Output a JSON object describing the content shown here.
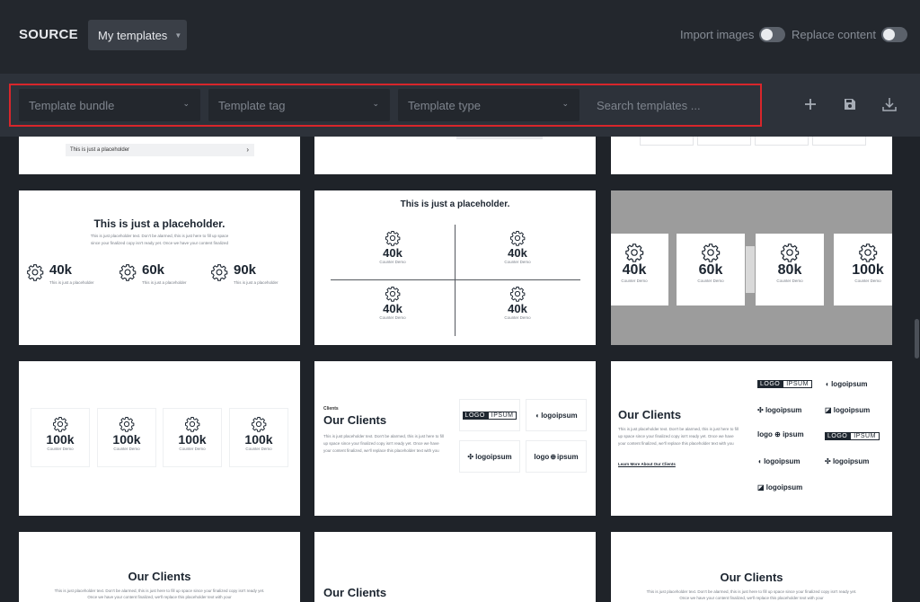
{
  "topbar": {
    "brand": "SOURCE",
    "templates_select": "My templates",
    "import_images_label": "Import images",
    "replace_content_label": "Replace content"
  },
  "filters": {
    "bundle_placeholder": "Template bundle",
    "tag_placeholder": "Template tag",
    "type_placeholder": "Template type",
    "search_placeholder": "Search templates ..."
  },
  "icons": {
    "add": "plus-icon",
    "save": "save-icon",
    "download": "download-icon"
  },
  "colors": {
    "highlight_outline": "#d8262b",
    "topbar_bg": "#23272d",
    "filterbar_bg": "#2d323a"
  },
  "cards": {
    "row0": {
      "placeholder_bar": "This is just a placeholder"
    },
    "counter1": {
      "title": "This is just a placeholder.",
      "desc": "This is just placeholder text. Don't be alarmed, this is just here to fill up space since your finalized copy isn't ready yet. Once we have your content finalized",
      "items": [
        {
          "value": "40k",
          "caption": "This is just a placeholder"
        },
        {
          "value": "60k",
          "caption": "This is just a placeholder"
        },
        {
          "value": "90k",
          "caption": "This is just a placeholder"
        }
      ]
    },
    "counter2": {
      "title": "This is just a placeholder.",
      "items": [
        {
          "value": "40k",
          "caption": "Counter Demo"
        },
        {
          "value": "40k",
          "caption": "Counter Demo"
        },
        {
          "value": "40k",
          "caption": "Counter Demo"
        },
        {
          "value": "40k",
          "caption": "Counter Demo"
        }
      ]
    },
    "counter3": {
      "items": [
        {
          "value": "40k",
          "caption": "Counter Demo"
        },
        {
          "value": "60k",
          "caption": "Counter Demo"
        },
        {
          "value": "80k",
          "caption": "Counter Demo"
        },
        {
          "value": "100k",
          "caption": "Counter Demo"
        }
      ]
    },
    "counter4": {
      "items": [
        {
          "value": "100k",
          "caption": "Counter Demo"
        },
        {
          "value": "100k",
          "caption": "Counter Demo"
        },
        {
          "value": "100k",
          "caption": "Counter Demo"
        },
        {
          "value": "100k",
          "caption": "Counter Demo"
        }
      ]
    },
    "clients1": {
      "eyebrow": "Clients",
      "title": "Our Clients",
      "desc": "This is just placeholder text. Don't be alarmed, this is just here to fill up space since your finalized copy isn't ready yet. Once we have your content finalized, we'll replace this placeholder text with you",
      "logos": [
        "LOGO",
        "IPSUM",
        "logoipsum",
        "logoipsum",
        "logo",
        "ipsum"
      ]
    },
    "clients2": {
      "title": "Our Clients",
      "desc": "This is just placeholder text. Don't be alarmed, this is just here to fill up space since your finalized copy isn't ready yet. Once we have your content finalized, we'll replace this placeholder text with you",
      "link": "Learn More About Our Clients",
      "logos": [
        "LOGO",
        "IPSUM",
        "logoipsum",
        "logoipsum",
        "logoipsum",
        "logo",
        "ipsum",
        "LOGO",
        "IPSUM",
        "logoipsum",
        "logoipsum",
        "logoipsum"
      ]
    },
    "clients3": {
      "title": "Our Clients",
      "desc": "This is just placeholder text. Don't be alarmed, this is just here to fill up space since your finalized copy isn't ready yet. Once we have your content finalized, we'll replace this placeholder text with your"
    },
    "clients4": {
      "title": "Our Clients"
    },
    "clients5": {
      "title": "Our Clients",
      "desc": "This is just placeholder text. Don't be alarmed, this is just here to fill up space since your finalized copy isn't ready yet. Once we have your content finalized, we'll replace this placeholder text with your"
    }
  }
}
